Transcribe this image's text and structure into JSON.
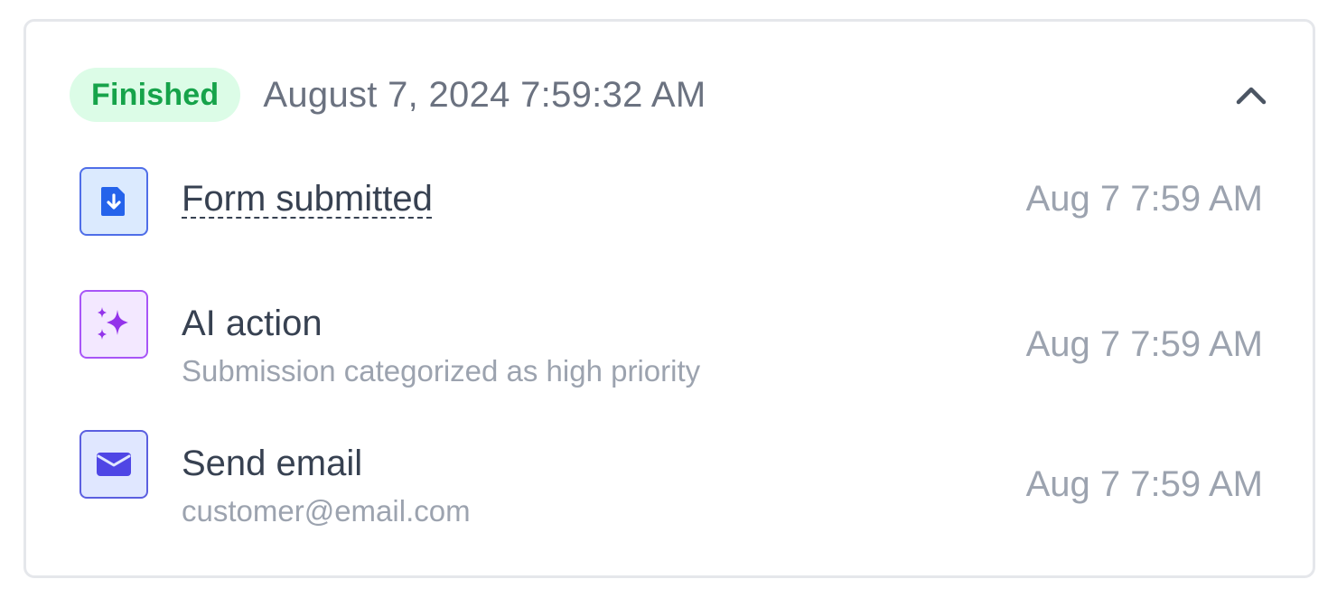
{
  "status": {
    "badge_label": "Finished",
    "badge_color": "#16a34a",
    "badge_bg": "#dcfce7",
    "datetime": "August 7, 2024 7:59:32 AM",
    "toggle_icon": "chevron-up-icon"
  },
  "events": [
    {
      "title": "Form submitted",
      "subtitle": "",
      "time": "Aug 7 7:59 AM",
      "icon": "file-download-icon",
      "accent": "#2563eb"
    },
    {
      "title": "AI action",
      "subtitle": "Submission categorized as high priority",
      "time": "Aug 7 7:59 AM",
      "icon": "sparkles-icon",
      "accent": "#9333ea"
    },
    {
      "title": "Send email",
      "subtitle": "customer@email.com",
      "time": "Aug 7 7:59 AM",
      "icon": "envelope-icon",
      "accent": "#4f46e5"
    }
  ]
}
